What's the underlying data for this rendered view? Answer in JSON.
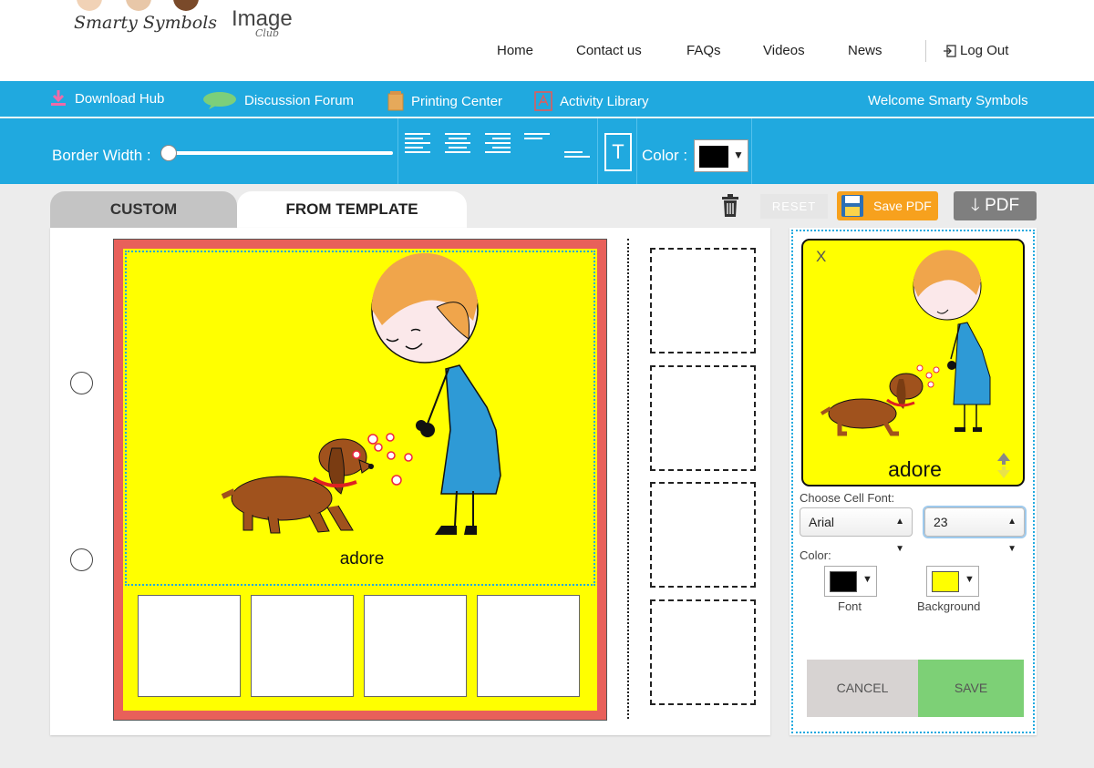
{
  "brand": {
    "script_text": "Smarty Symbols",
    "image_text": "Image",
    "club_text": "Club"
  },
  "nav": {
    "home": "Home",
    "contact": "Contact us",
    "faqs": "FAQs",
    "videos": "Videos",
    "news": "News",
    "logout": "Log Out"
  },
  "menubar": {
    "download_hub": "Download Hub",
    "discussion_forum": "Discussion Forum",
    "printing_center": "Printing Center",
    "activity_library": "Activity Library",
    "welcome": "Welcome Smarty Symbols"
  },
  "toolbar": {
    "border_width_label": "Border Width :",
    "border_width_value": 0,
    "text_button": "T",
    "color_label": "Color :",
    "color_value": "#000000"
  },
  "tabs": {
    "custom": "CUSTOM",
    "from_template": "FROM TEMPLATE",
    "active": "FROM TEMPLATE"
  },
  "actions": {
    "reset": "RESET",
    "save_pdf": "Save PDF",
    "pdf": "PDF"
  },
  "board": {
    "border_color": "#e8605a",
    "background_color": "#ffff00",
    "main_cell_label": "adore"
  },
  "editor": {
    "close": "X",
    "preview_label": "adore",
    "choose_font_label": "Choose Cell Font:",
    "font_family": "Arial",
    "font_size": "23",
    "color_label": "Color:",
    "font_color_label": "Font",
    "font_color": "#000000",
    "background_color_label": "Background",
    "background_color": "#ffff00",
    "cancel": "CANCEL",
    "save": "SAVE"
  },
  "colors": {
    "accent": "#20a9df",
    "save_pdf": "#f7a11d",
    "pdf": "#7f7f7f",
    "save": "#7dd076",
    "cancel": "#d7d3d2"
  }
}
